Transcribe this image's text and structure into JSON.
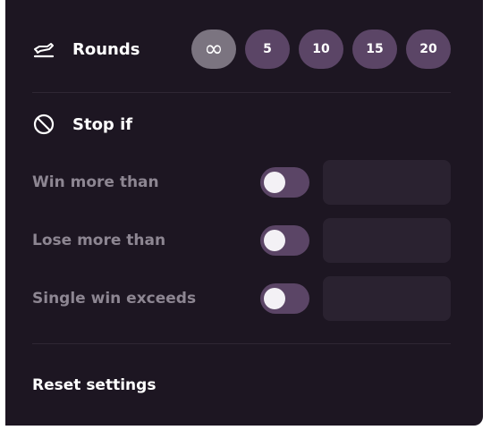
{
  "rounds": {
    "label": "Rounds",
    "icon": "plane-takeoff-icon",
    "options": [
      {
        "label": "∞",
        "selected": true
      },
      {
        "label": "5",
        "selected": false
      },
      {
        "label": "10",
        "selected": false
      },
      {
        "label": "15",
        "selected": false
      },
      {
        "label": "20",
        "selected": false
      }
    ]
  },
  "stop_if": {
    "label": "Stop if",
    "icon": "prohibited-icon",
    "conditions": [
      {
        "label": "Win more than",
        "enabled": false,
        "value": ""
      },
      {
        "label": "Lose more than",
        "enabled": false,
        "value": ""
      },
      {
        "label": "Single win exceeds",
        "enabled": false,
        "value": ""
      }
    ]
  },
  "reset": {
    "label": "Reset settings"
  },
  "colors": {
    "panel_bg": "#1d1622",
    "pill_bg": "#5b4566",
    "pill_selected_bg": "#7b7480",
    "input_bg": "#2a2230",
    "muted_text": "#8d8692"
  }
}
